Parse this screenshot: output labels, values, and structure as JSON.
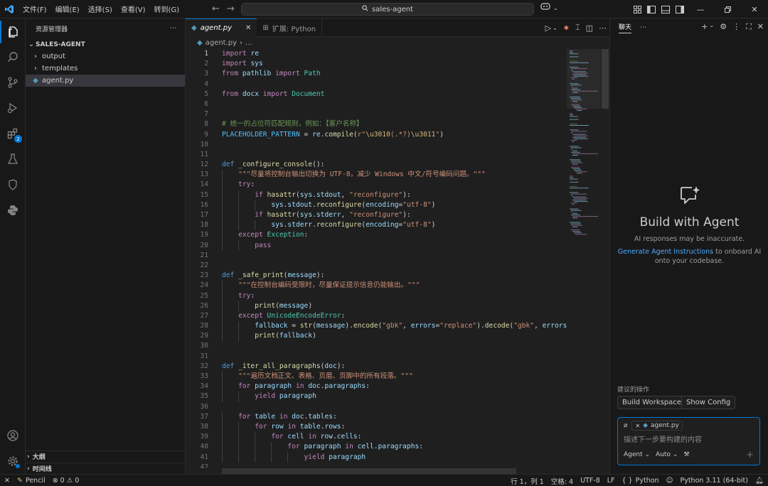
{
  "menu": [
    "文件(F)",
    "编辑(E)",
    "选择(S)",
    "查看(V)",
    "转到(G)"
  ],
  "title_search": "sales-agent",
  "explorer": {
    "header": "资源管理器",
    "root": "SALES-AGENT",
    "items": [
      {
        "label": "output",
        "type": "folder"
      },
      {
        "label": "templates",
        "type": "folder"
      },
      {
        "label": "agent.py",
        "type": "file"
      }
    ],
    "outline": "大纲",
    "timeline": "时间线"
  },
  "tabs": [
    {
      "label": "agent.py",
      "active": true
    },
    {
      "label": "扩展: Python",
      "active": false
    }
  ],
  "breadcrumb": [
    "agent.py",
    "..."
  ],
  "code_lines": [
    "import re",
    "import sys",
    "from pathlib import Path",
    "",
    "from docx import Document",
    "",
    "",
    "# 统一的占位符匹配规则，例如：【客户名称】",
    "PLACEHOLDER_PATTERN = re.compile(r\"\\u3010(.*?)\\u3011\")",
    "",
    "",
    "def _configure_console():",
    "    \"\"\"尽量将控制台输出切换为 UTF-8，减少 Windows 中文/符号编码问题。\"\"\"",
    "    try:",
    "        if hasattr(sys.stdout, \"reconfigure\"):",
    "            sys.stdout.reconfigure(encoding=\"utf-8\")",
    "        if hasattr(sys.stderr, \"reconfigure\"):",
    "            sys.stderr.reconfigure(encoding=\"utf-8\")",
    "    except Exception:",
    "        pass",
    "",
    "",
    "def _safe_print(message):",
    "    \"\"\"在控制台编码受限时，尽量保证提示信息仍能输出。\"\"\"",
    "    try:",
    "        print(message)",
    "    except UnicodeEncodeError:",
    "        fallback = str(message).encode(\"gbk\", errors=\"replace\").decode(\"gbk\", errors",
    "        print(fallback)",
    "",
    "",
    "def _iter_all_paragraphs(doc):",
    "    \"\"\"遍历文档正文、表格、页眉、页脚中的所有段落。\"\"\"",
    "    for paragraph in doc.paragraphs:",
    "        yield paragraph",
    "",
    "    for table in doc.tables:",
    "        for row in table.rows:",
    "            for cell in row.cells:",
    "                for paragraph in cell.paragraphs:",
    "                    yield paragraph",
    ""
  ],
  "chat": {
    "tab": "聊天",
    "welcome_title": "Build with Agent",
    "welcome_sub": "AI responses may be inaccurate.",
    "welcome_link": "Generate Agent Instructions",
    "welcome_desc_1": "to onboard AI",
    "welcome_desc_2": "onto your codebase.",
    "suggest_label": "建议的操作",
    "suggestions": [
      "Build Workspace",
      "Show Config"
    ],
    "context_file": "agent.py",
    "input_placeholder": "描述下一步要构建的内容",
    "mode": "Agent",
    "model": "Auto"
  },
  "status": {
    "profile": "Pencil",
    "errors": "0",
    "warnings": "0",
    "position": "行 1，列 1",
    "spaces": "空格: 4",
    "encoding": "UTF-8",
    "eol": "LF",
    "language": "Python",
    "interpreter": "Python 3.11 (64-bit)"
  },
  "colors": {
    "accent": "#0078d4",
    "editor_bg": "#1f1f1f",
    "chrome_bg": "#181818",
    "link": "#4daafc"
  }
}
